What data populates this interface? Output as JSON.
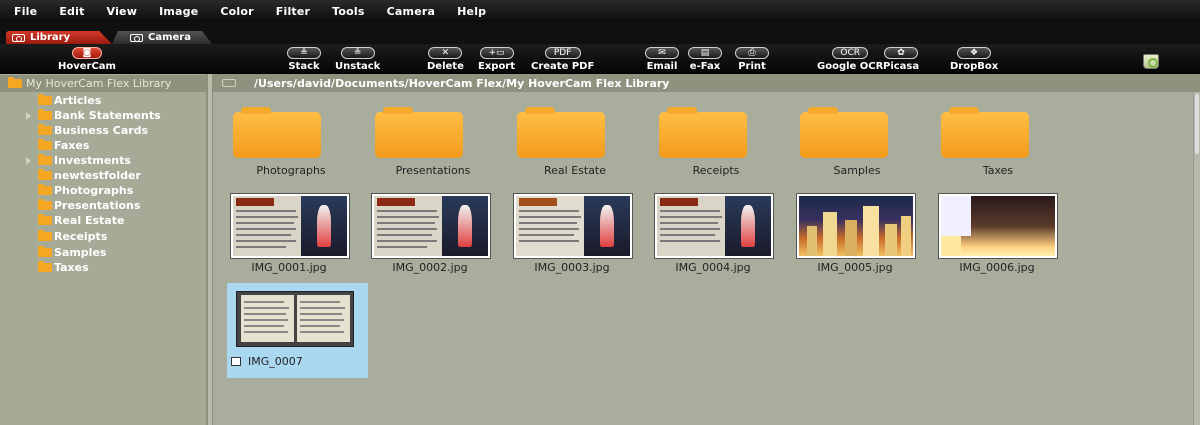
{
  "menu": [
    "File",
    "Edit",
    "View",
    "Image",
    "Color",
    "Filter",
    "Tools",
    "Camera",
    "Help"
  ],
  "tabs": {
    "library": "Library",
    "camera": "Camera"
  },
  "toolbar": {
    "hovercam": "HoverCam",
    "stack": "Stack",
    "unstack": "Unstack",
    "delete": "Delete",
    "export": "Export",
    "create_pdf": "Create PDF",
    "pdf_glyph": "PDF",
    "email": "Email",
    "efax": "e-Fax",
    "print": "Print",
    "google_ocr": "Google OCR",
    "ocr_glyph": "OCR",
    "picasa": "Picasa",
    "dropbox": "DropBox"
  },
  "sidebar": {
    "root": "My HoverCam Flex Library",
    "items": [
      {
        "label": "Articles",
        "expandable": false
      },
      {
        "label": "Bank Statements",
        "expandable": true
      },
      {
        "label": "Business Cards",
        "expandable": false
      },
      {
        "label": "Faxes",
        "expandable": false
      },
      {
        "label": "Investments",
        "expandable": true
      },
      {
        "label": "newtestfolder",
        "expandable": false
      },
      {
        "label": "Photographs",
        "expandable": false
      },
      {
        "label": "Presentations",
        "expandable": false
      },
      {
        "label": "Real Estate",
        "expandable": false
      },
      {
        "label": "Receipts",
        "expandable": false
      },
      {
        "label": "Samples",
        "expandable": false
      },
      {
        "label": "Taxes",
        "expandable": false
      }
    ]
  },
  "path": "/Users/david/Documents/HoverCam Flex/My HoverCam Flex Library",
  "folders": [
    "Photographs",
    "Presentations",
    "Real Estate",
    "Receipts",
    "Samples",
    "Taxes"
  ],
  "images": [
    "IMG_0001.jpg",
    "IMG_0002.jpg",
    "IMG_0003.jpg",
    "IMG_0004.jpg",
    "IMG_0005.jpg",
    "IMG_0006.jpg"
  ],
  "stack_item": {
    "label": "IMG_0007",
    "selected": true
  },
  "colors": {
    "accent_red": "#c62a1c",
    "folder": "#f5a623",
    "selection": "#aad8f0",
    "background": "#a9ae9c"
  }
}
